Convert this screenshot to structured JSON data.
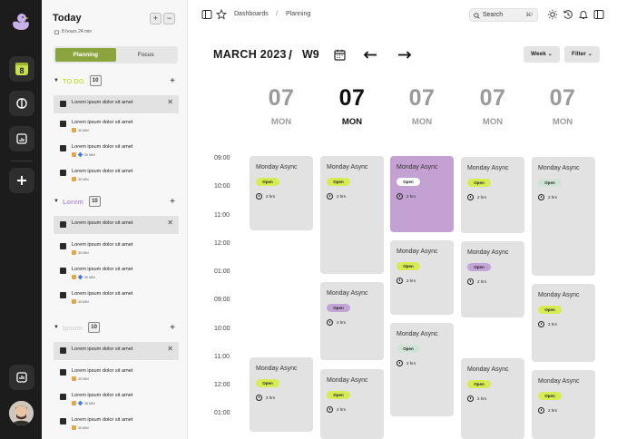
{
  "sidebar": {
    "title": "Today",
    "subtitle": "8 hours 24 min",
    "tabs": [
      "Planning",
      "Focus"
    ],
    "rail_badge": "8",
    "sections": [
      {
        "name": "TO DO",
        "color": "#c8e04a",
        "count": "10",
        "tasks": [
          {
            "text": "Lorem ipsum dolor sit amet",
            "meta": ""
          },
          {
            "text": "Lorem ipsum dolor sit amet",
            "meta": "30 MIN"
          },
          {
            "text": "Lorem ipsum dolor sit amet",
            "meta": "30 MIN"
          },
          {
            "text": "Lorem ipsum dolor sit amet",
            "meta": "30 MIN"
          }
        ]
      },
      {
        "name": "Lorem",
        "color": "#b79ad4",
        "count": "10",
        "tasks": [
          {
            "text": "Lorem ipsum dolor sit amet",
            "meta": ""
          },
          {
            "text": "Lorem ipsum dolor sit amet",
            "meta": "30 MIN"
          },
          {
            "text": "Lorem ipsum dolor sit amet",
            "meta": "30 MIN"
          },
          {
            "text": "Lorem ipsum dolor sit amet",
            "meta": "30 MIN"
          }
        ]
      },
      {
        "name": "Ipsum",
        "color": "#d6d6d6",
        "count": "10",
        "tasks": [
          {
            "text": "Lorem ipsum dolor sit amet",
            "meta": ""
          },
          {
            "text": "Lorem ipsum dolor sit amet",
            "meta": "30 MIN"
          },
          {
            "text": "Lorem ipsum dolor sit amet",
            "meta": "30 MIN"
          },
          {
            "text": "Lorem ipsum dolor sit amet",
            "meta": "30 MIN"
          }
        ]
      }
    ]
  },
  "topbar": {
    "breadcrumbs": [
      "Dashboards",
      "/",
      "Planning"
    ],
    "search_label": "Search",
    "search_shortcut": "⌘/"
  },
  "calendar": {
    "month": "MARCH 2023",
    "separator": "/",
    "week": "W9",
    "view_label": "Week",
    "filter_label": "Filter",
    "days": [
      {
        "num": "07",
        "name": "MON",
        "today": false
      },
      {
        "num": "07",
        "name": "MON",
        "today": true
      },
      {
        "num": "07",
        "name": "MON",
        "today": false
      },
      {
        "num": "07",
        "name": "MON",
        "today": false
      },
      {
        "num": "07",
        "name": "MON",
        "today": false
      }
    ],
    "times": [
      "09:00",
      "10:00",
      "11:00",
      "12:00",
      "01:00",
      "09:00",
      "10:00",
      "11:00",
      "12:00",
      "01:00"
    ],
    "event_title": "Monday Async",
    "status_label": "Open",
    "duration": "2 hrs",
    "colors": {
      "lime": "#d7ec52",
      "lilac": "#c2a4d6",
      "mint": "#cfe3d6",
      "white": "#ffffff",
      "purple_card": "#c3a2d3",
      "grey_card": "#e2e2e2"
    }
  }
}
